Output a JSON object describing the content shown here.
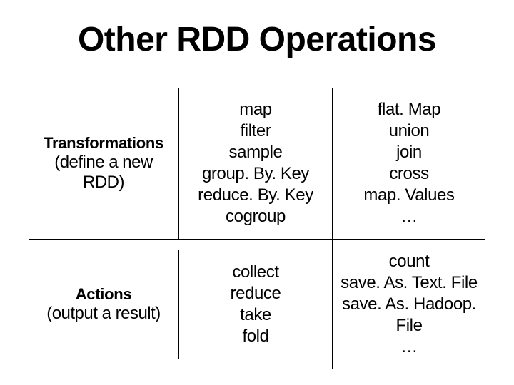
{
  "title": "Other RDD Operations",
  "rows": [
    {
      "header": "Transformations",
      "sub": "(define a new RDD)",
      "col1": [
        "map",
        "filter",
        "sample",
        "group. By. Key",
        "reduce. By. Key",
        "cogroup"
      ],
      "col2": [
        "flat. Map",
        "union",
        "join",
        "cross",
        "map. Values",
        "…"
      ]
    },
    {
      "header": "Actions",
      "sub": "(output a result)",
      "col1": [
        "collect",
        "reduce",
        "take",
        "fold"
      ],
      "col2": [
        "count",
        "save. As. Text. File",
        "save. As. Hadoop. File",
        "…"
      ]
    }
  ]
}
